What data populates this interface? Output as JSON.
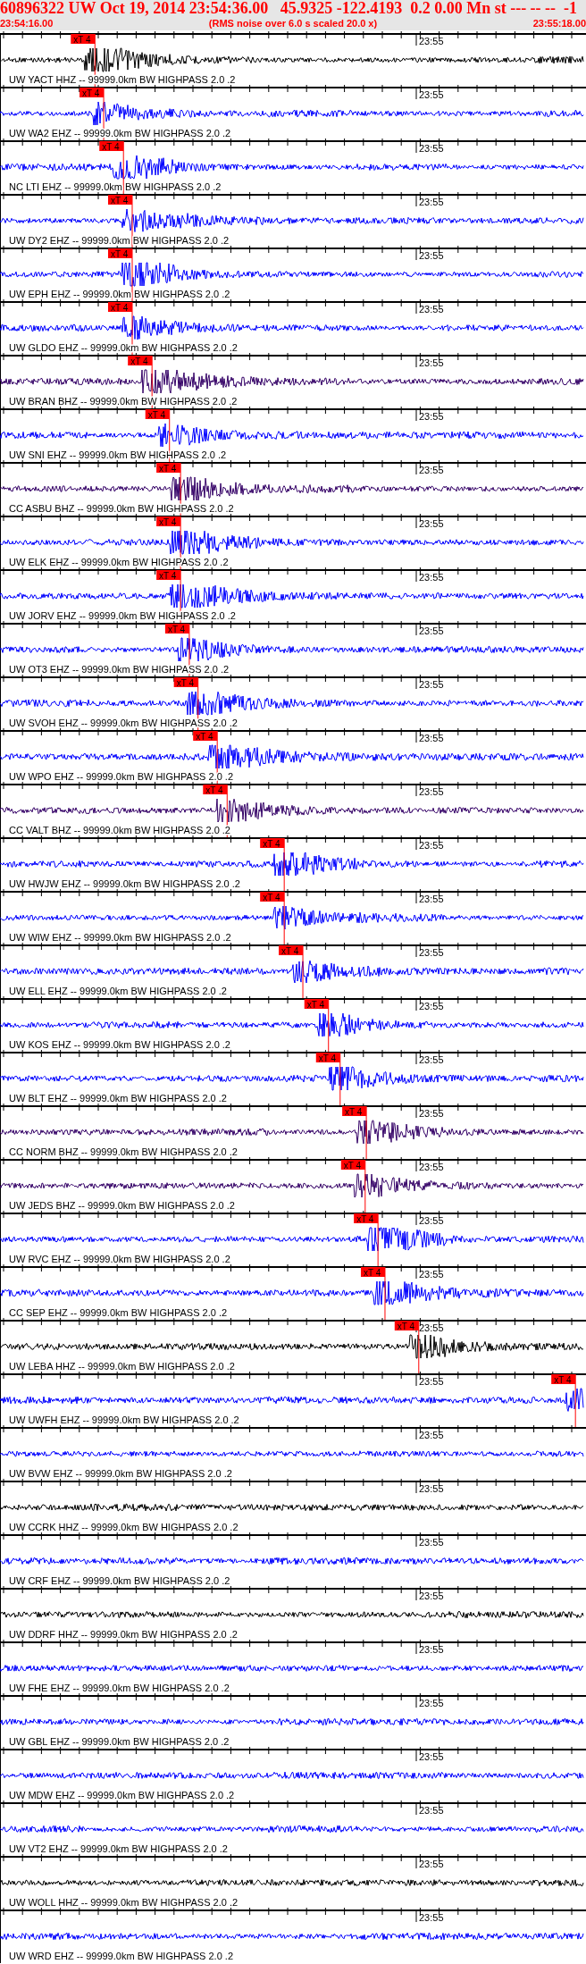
{
  "header": {
    "title": "60896322 UW Oct 19, 2014 23:54:36.00   45.9325 -122.4193  0.2 0.00 Mn st --- -- --  -1",
    "start_time": "23:54:16.00",
    "note": "(RMS noise over 6.0 s scaled 20.0 x)",
    "end_time": "23:55:18.00"
  },
  "traces": [
    {
      "label": "UW YACT HHZ -- 99999.0km BW  HIGHPASS  2.0 .2",
      "tick_label": "23:55",
      "color": "#000000",
      "pick": {
        "label": "xT 4",
        "level": 0.163
      }
    },
    {
      "label": "UW WA2 EHZ -- 99999.0km BW  HIGHPASS  2.0 .2",
      "tick_label": "23:55",
      "color": "#0000ff",
      "pick": {
        "label": "xT 4",
        "level": 0.178
      }
    },
    {
      "label": "NC LTI EHZ -- 99999.0km BW  HIGHPASS  2.0 .2",
      "tick_label": "23:55",
      "color": "#0000ff",
      "pick": {
        "label": "xT 4",
        "level": 0.212
      }
    },
    {
      "label": "UW DY2 EHZ -- 99999.0km BW  HIGHPASS  2.0 .2",
      "tick_label": "23:55",
      "color": "#0000ff",
      "pick": {
        "label": "xT 4",
        "level": 0.227
      }
    },
    {
      "label": "UW EPH EHZ -- 99999.0km BW  HIGHPASS  2.0 .2",
      "tick_label": "23:55",
      "color": "#0000ff",
      "pick": {
        "label": "xT 4",
        "level": 0.227
      }
    },
    {
      "label": "UW GLDO EHZ -- 99999.0km BW  HIGHPASS  2.0 .2",
      "tick_label": "23:55",
      "color": "#0000ff",
      "pick": {
        "label": "xT 4",
        "level": 0.227
      }
    },
    {
      "label": "UW BRAN BHZ -- 99999.0km BW  HIGHPASS  2.0 .2",
      "tick_label": "23:55",
      "color": "#330066",
      "pick": {
        "label": "xT 4",
        "level": 0.261
      }
    },
    {
      "label": "UW SNI EHZ -- 99999.0km BW  HIGHPASS  2.0 .2",
      "tick_label": "23:55",
      "color": "#0000ff",
      "pick": {
        "label": "xT 4",
        "level": 0.291
      }
    },
    {
      "label": "CC ASBU BHZ -- 99999.0km BW  HIGHPASS  2.0 .2",
      "tick_label": "23:55",
      "color": "#330066",
      "pick": {
        "label": "xT 4",
        "level": 0.31
      }
    },
    {
      "label": "UW ELK EHZ -- 99999.0km BW  HIGHPASS  2.0 .2",
      "tick_label": "23:55",
      "color": "#0000ff",
      "pick": {
        "label": "xT 4",
        "level": 0.31
      }
    },
    {
      "label": "UW JORV EHZ -- 99999.0km BW  HIGHPASS  2.0 .2",
      "tick_label": "23:55",
      "color": "#0000ff",
      "pick": {
        "label": "xT 4",
        "level": 0.31
      }
    },
    {
      "label": "UW OT3 EHZ -- 99999.0km BW  HIGHPASS  2.0 .2",
      "tick_label": "23:55",
      "color": "#0000ff",
      "pick": {
        "label": "xT 4",
        "level": 0.325
      }
    },
    {
      "label": "UW SVOH EHZ -- 99999.0km BW  HIGHPASS  2.0 .2",
      "tick_label": "23:55",
      "color": "#0000ff",
      "pick": {
        "label": "xT 4",
        "level": 0.34
      }
    },
    {
      "label": "UW WPO EHZ -- 99999.0km BW  HIGHPASS  2.0 .2",
      "tick_label": "23:55",
      "color": "#0000ff",
      "pick": {
        "label": "xT 4",
        "level": 0.373
      }
    },
    {
      "label": "CC VALT BHZ -- 99999.0km BW  HIGHPASS  2.0 .2",
      "tick_label": "23:55",
      "color": "#330066",
      "pick": {
        "label": "xT 4",
        "level": 0.39
      }
    },
    {
      "label": "UW HWJW EHZ -- 99999.0km BW  HIGHPASS  2.0 .2",
      "tick_label": "23:55",
      "color": "#0000ff",
      "pick": {
        "label": "xT 4",
        "level": 0.488
      }
    },
    {
      "label": "UW WIW EHZ -- 99999.0km BW  HIGHPASS  2.0 .2",
      "tick_label": "23:55",
      "color": "#0000ff",
      "pick": {
        "label": "xT 4",
        "level": 0.488
      }
    },
    {
      "label": "UW ELL EHZ -- 99999.0km BW  HIGHPASS  2.0 .2",
      "tick_label": "23:55",
      "color": "#0000ff",
      "pick": {
        "label": "xT 4",
        "level": 0.52
      }
    },
    {
      "label": "UW KOS EHZ -- 99999.0km BW  HIGHPASS  2.0 .2",
      "tick_label": "23:55",
      "color": "#0000ff",
      "pick": {
        "label": "xT 4",
        "level": 0.564
      }
    },
    {
      "label": "UW BLT EHZ -- 99999.0km BW  HIGHPASS  2.0 .2",
      "tick_label": "23:55",
      "color": "#0000ff",
      "pick": {
        "label": "xT 4",
        "level": 0.584
      }
    },
    {
      "label": "CC NORM BHZ -- 99999.0km BW  HIGHPASS  2.0 .2",
      "tick_label": "23:55",
      "color": "#330066",
      "pick": {
        "label": "xT 4",
        "level": 0.629
      }
    },
    {
      "label": "UW JEDS BHZ -- 99999.0km BW  HIGHPASS  2.0 .2",
      "tick_label": "23:55",
      "color": "#330066",
      "pick": {
        "label": "xT 4",
        "level": 0.627
      }
    },
    {
      "label": "UW RVC EHZ -- 99999.0km BW  HIGHPASS  2.0 .2",
      "tick_label": "23:55",
      "color": "#0000ff",
      "pick": {
        "label": "xT 4",
        "level": 0.649
      }
    },
    {
      "label": "CC SEP EHZ -- 99999.0km BW  HIGHPASS  2.0 .2",
      "tick_label": "23:55",
      "color": "#0000ff",
      "pick": {
        "label": "xT 4",
        "level": 0.661
      }
    },
    {
      "label": "UW LEBA HHZ -- 99999.0km BW  HIGHPASS  2.0 .2",
      "tick_label": "23:55",
      "color": "#000000",
      "pick": {
        "label": "xT 4",
        "level": 0.719
      }
    },
    {
      "label": "UW UWFH EHZ -- 99999.0km BW  HIGHPASS  2.0 .2",
      "tick_label": "23:55",
      "color": "#0000ff",
      "pick": {
        "label": "xT 4",
        "level": 0.988
      }
    },
    {
      "label": "UW BVW EHZ -- 99999.0km BW  HIGHPASS  2.0 .2",
      "tick_label": "23:55",
      "color": "#0000ff"
    },
    {
      "label": "UW CCRK HHZ -- 99999.0km BW  HIGHPASS  2.0 .2",
      "tick_label": "23:55",
      "color": "#000000"
    },
    {
      "label": "UW CRF EHZ -- 99999.0km BW  HIGHPASS  2.0 .2",
      "tick_label": "23:55",
      "color": "#0000ff"
    },
    {
      "label": "UW DDRF HHZ -- 99999.0km BW  HIGHPASS  2.0 .2",
      "tick_label": "23:55",
      "color": "#000000"
    },
    {
      "label": "UW FHE EHZ -- 99999.0km BW  HIGHPASS  2.0 .2",
      "tick_label": "23:55",
      "color": "#0000ff"
    },
    {
      "label": "UW GBL EHZ -- 99999.0km BW  HIGHPASS  2.0 .2",
      "tick_label": "23:55",
      "color": "#0000ff"
    },
    {
      "label": "UW MDW EHZ -- 99999.0km BW  HIGHPASS  2.0 .2",
      "tick_label": "23:55",
      "color": "#0000ff"
    },
    {
      "label": "UW VT2 EHZ -- 99999.0km BW  HIGHPASS  2.0 .2",
      "tick_label": "23:55",
      "color": "#0000ff"
    },
    {
      "label": "UW WOLL HHZ -- 99999.0km BW  HIGHPASS  2.0 .2",
      "tick_label": "23:55",
      "color": "#000000"
    },
    {
      "label": "UW WRD EHZ -- 99999.0km BW  HIGHPASS  2.0 .2",
      "tick_label": "23:55",
      "color": "#0000ff"
    }
  ]
}
